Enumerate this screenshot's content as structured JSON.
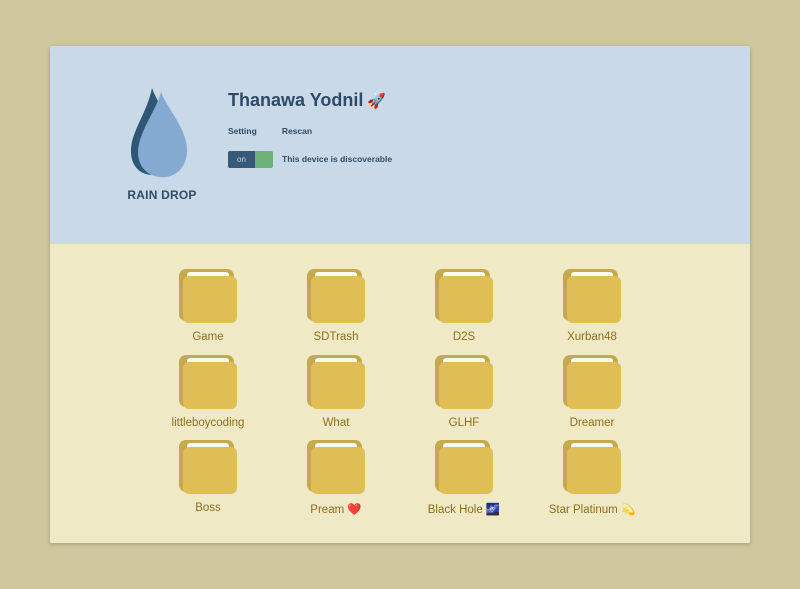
{
  "app": {
    "brand": "RAIN DROP",
    "colors": {
      "header_bg": "#c9d9e8",
      "content_bg": "#f0e9c6",
      "accent": "#324b66",
      "toggle_on": "#6db07a",
      "folder": "#dfbf55"
    }
  },
  "user": {
    "name": "Thanawa Yodnil",
    "emoji": "🚀"
  },
  "menu": {
    "setting": "Setting",
    "rescan": "Rescan"
  },
  "discoverable": {
    "toggle_text": "on",
    "state": true,
    "label": "This device is discoverable"
  },
  "folders": [
    {
      "name": "Game",
      "icon": "folder-icon"
    },
    {
      "name": "SDTrash",
      "icon": "folder-icon"
    },
    {
      "name": "D2S",
      "icon": "folder-icon"
    },
    {
      "name": "Xurban48",
      "icon": "folder-icon"
    },
    {
      "name": "littleboycoding",
      "icon": "folder-icon"
    },
    {
      "name": "What",
      "icon": "folder-icon"
    },
    {
      "name": "GLHF",
      "icon": "folder-icon"
    },
    {
      "name": "Dreamer",
      "icon": "folder-icon"
    },
    {
      "name": "Boss",
      "icon": "folder-icon"
    },
    {
      "name": "Pream ❤️",
      "icon": "folder-icon"
    },
    {
      "name": "Black Hole 🌌",
      "icon": "folder-icon"
    },
    {
      "name": "Star Platinum 💫",
      "icon": "folder-icon"
    }
  ]
}
